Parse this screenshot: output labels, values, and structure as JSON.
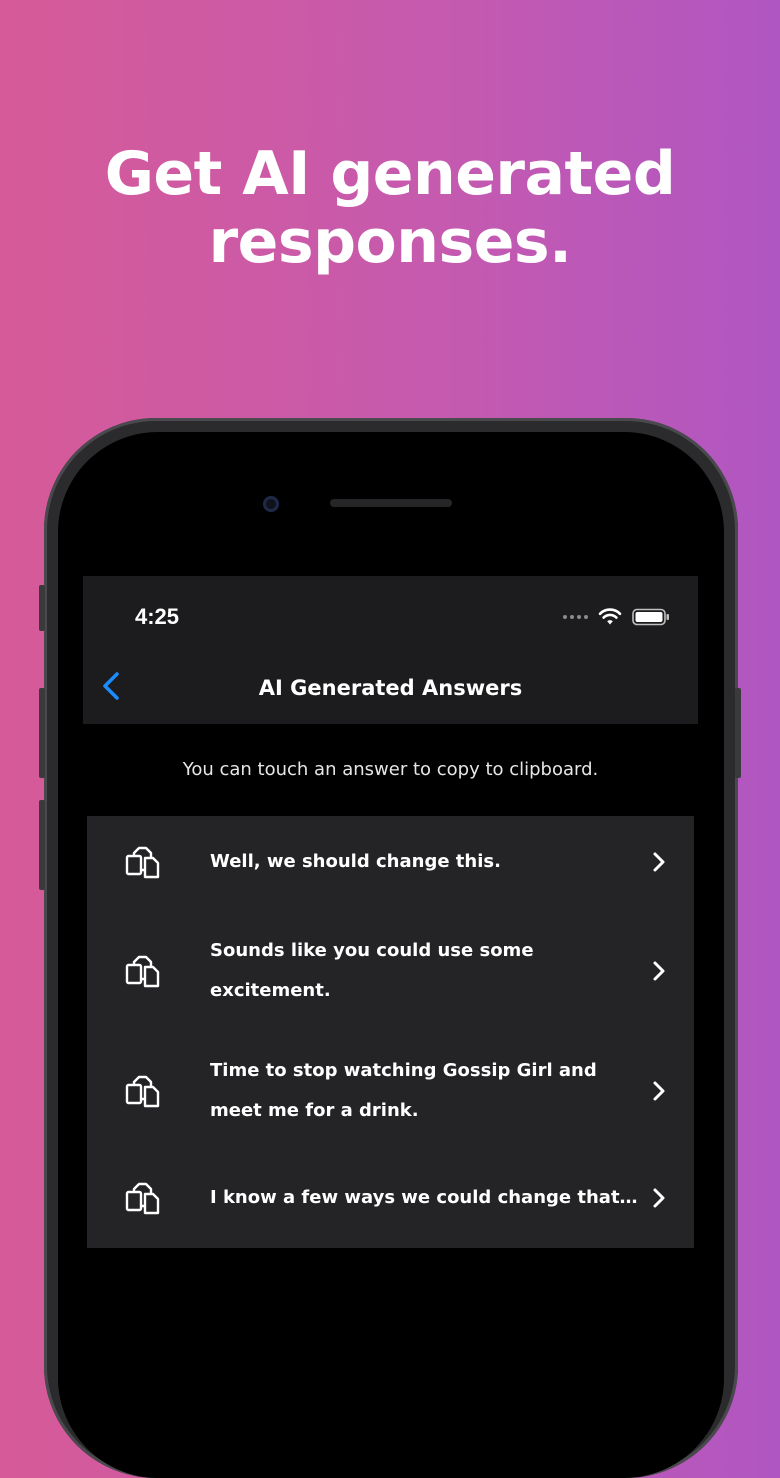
{
  "headline": {
    "line1": "Get AI generated",
    "line2": "responses."
  },
  "status_bar": {
    "time": "4:25"
  },
  "nav": {
    "title": "AI Generated Answers",
    "back_icon": "chevron-left-icon"
  },
  "info_text": "You can touch an answer to copy to clipboard.",
  "answers": [
    {
      "text": "Well, we should change this."
    },
    {
      "text": "Sounds like you could use some excitement."
    },
    {
      "text": "Time to stop watching Gossip Girl and meet me for a drink."
    },
    {
      "text": "I know a few ways we could change that..."
    }
  ],
  "colors": {
    "accent_blue": "#1a8cff",
    "list_background": "#242426",
    "screen_background": "#000000"
  }
}
